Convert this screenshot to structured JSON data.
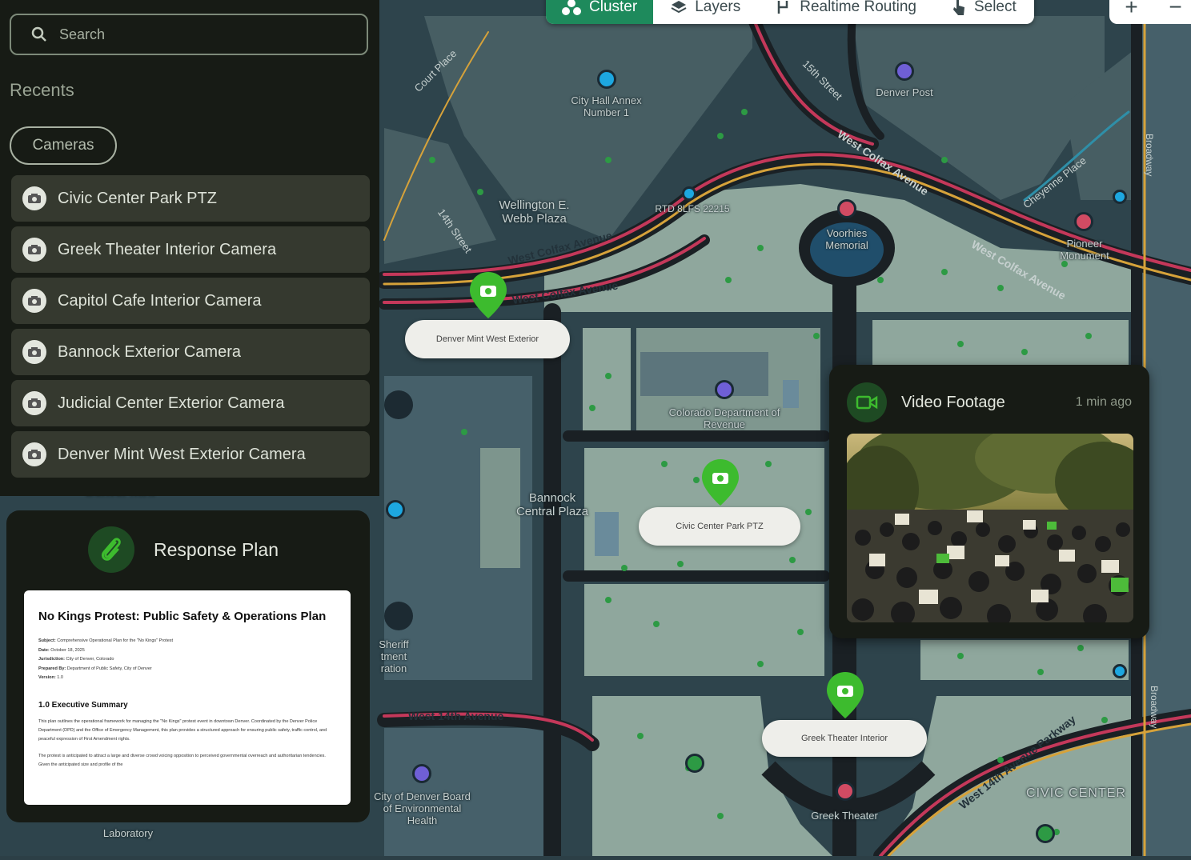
{
  "toolbar": {
    "cluster_label": "Cluster",
    "layers_label": "Layers",
    "routing_label": "Realtime Routing",
    "select_label": "Select",
    "zoom_in": "+",
    "zoom_out": "−"
  },
  "search": {
    "placeholder": "Search"
  },
  "recents": {
    "heading": "Recents",
    "filter_chip": "Cameras",
    "items": [
      {
        "label": "Civic Center Park PTZ"
      },
      {
        "label": "Greek Theater Interior Camera"
      },
      {
        "label": "Capitol Cafe Interior Camera"
      },
      {
        "label": "Bannock Exterior Camera"
      },
      {
        "label": "Judicial Center Exterior Camera"
      },
      {
        "label": "Denver Mint West Exterior Camera"
      }
    ]
  },
  "response_plan": {
    "title": "Response Plan",
    "doc_title": "No Kings Protest: Public Safety & Operations Plan",
    "meta": [
      {
        "key": "Subject:",
        "value": "Comprehensive Operational Plan for the \"No Kings\" Protest"
      },
      {
        "key": "Date:",
        "value": "October 18, 2025"
      },
      {
        "key": "Jurisdiction:",
        "value": "City of Denver, Colorado"
      },
      {
        "key": "Prepared By:",
        "value": "Department of Public Safety, City of Denver"
      },
      {
        "key": "Version:",
        "value": "1.0"
      }
    ],
    "section_title": "1.0 Executive Summary",
    "para1": "This plan outlines the operational framework for managing the \"No Kings\" protest event in downtown Denver. Coordinated by the Denver Police Department (DPD) and the Office of Emergency Management, this plan provides a structured approach for ensuring public safety, traffic control, and peaceful expression of First Amendment rights.",
    "para2": "The protest is anticipated to attract a large and diverse crowd voicing opposition to perceived governmental overreach and authoritarian tendencies. Given the anticipated size and profile of the"
  },
  "video": {
    "title": "Video Footage",
    "time": "1 min ago"
  },
  "markers": [
    {
      "label": "Denver Mint West Exterior"
    },
    {
      "label": "Civic Center Park PTZ"
    },
    {
      "label": "Greek Theater Interior"
    }
  ],
  "map_labels": {
    "city_hall": "City Hall Annex Number 1",
    "denver_post": "Denver Post",
    "wellington": "Wellington E. Webb Plaza",
    "rtd": "RTD 8LFS 22215",
    "voorhies": "Voorhies Memorial",
    "pioneer": "Pioneer Monument",
    "colorado_rev": "Colorado Department of Revenue",
    "bannock": "Bannock Central Plaza",
    "sheriff": "Sheriff tment ration",
    "city_board": "City of Denver Board of Environmental Health",
    "greek_theater": "Greek Theater",
    "civic_center": "CIVIC CENTER",
    "laboratory": "Laboratory",
    "denver_mint": "Denver Mint"
  },
  "streets": {
    "colfax_upper": "West Colfax Avenue",
    "colfax_lower": "West Colfax Avenue",
    "colfax_ne": "West Colfax Avenue",
    "colfax_east": "West Colfax Avenue",
    "fourteenth": "West 14th Avenue",
    "fourteenth_east": "West 14th Avenue Parkway",
    "courts": "Court Place",
    "street_14th": "14th Street",
    "street_15th": "15th Street",
    "cheyenne": "Cheyenne Place",
    "broadway": "Broadway",
    "broadway_lower": "Broadway"
  },
  "colors": {
    "accent_green": "#1e8a5c",
    "marker_green": "#3dbb2e",
    "panel_bg": "#171b15"
  }
}
